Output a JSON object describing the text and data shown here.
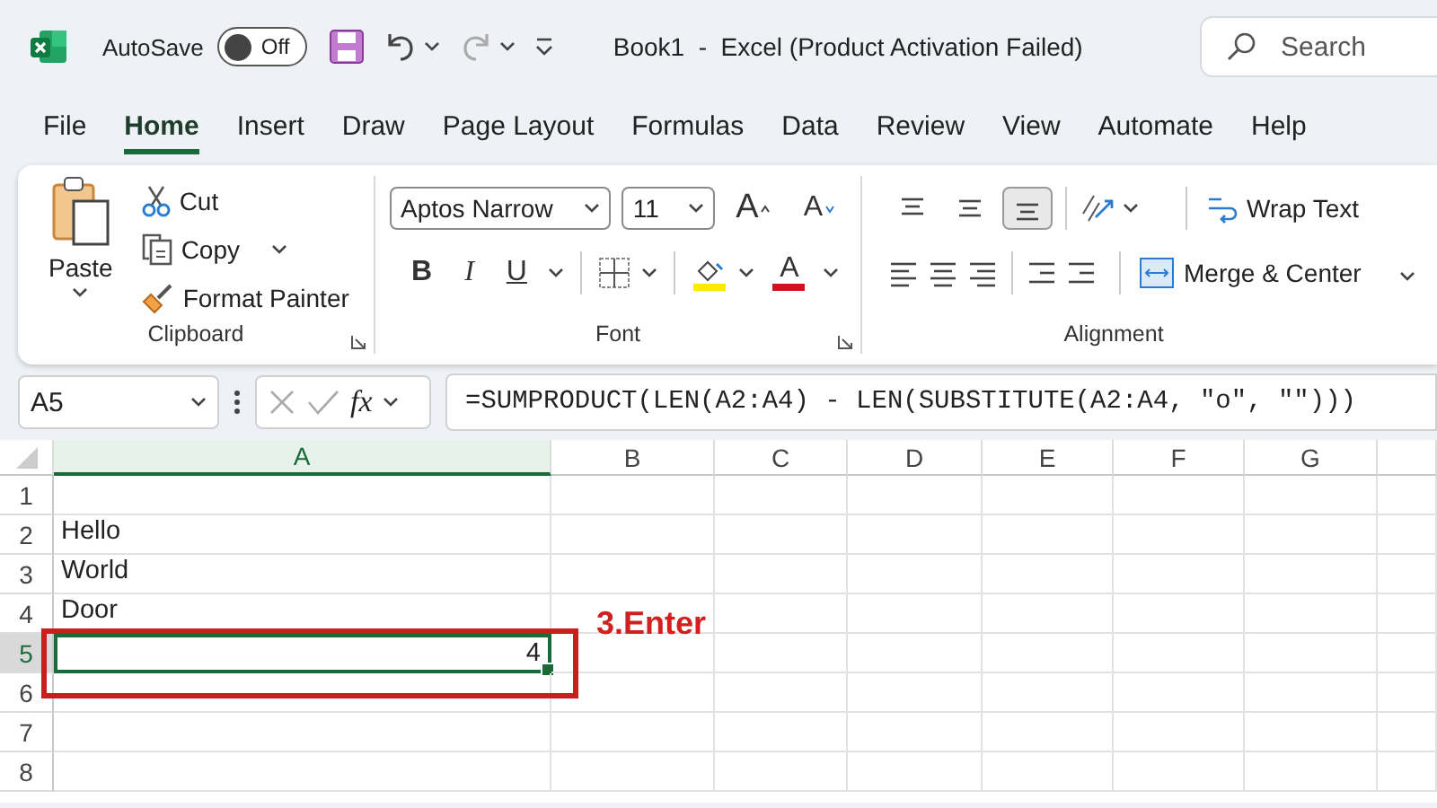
{
  "title_bar": {
    "autosave_label": "AutoSave",
    "autosave": {
      "on": false,
      "label": "Off"
    },
    "title": "Book1  -  Excel (Product Activation Failed)",
    "search": {
      "placeholder": "Search"
    }
  },
  "tabs": [
    {
      "label": "File",
      "selected": false
    },
    {
      "label": "Home",
      "selected": true
    },
    {
      "label": "Insert",
      "selected": false
    },
    {
      "label": "Draw",
      "selected": false
    },
    {
      "label": "Page Layout",
      "selected": false
    },
    {
      "label": "Formulas",
      "selected": false
    },
    {
      "label": "Data",
      "selected": false
    },
    {
      "label": "Review",
      "selected": false
    },
    {
      "label": "View",
      "selected": false
    },
    {
      "label": "Automate",
      "selected": false
    },
    {
      "label": "Help",
      "selected": false
    }
  ],
  "ribbon": {
    "clipboard": {
      "label": "Clipboard",
      "paste": "Paste",
      "cut": "Cut",
      "copy": "Copy",
      "format_painter": "Format Painter"
    },
    "font": {
      "label": "Font",
      "font_name": "Aptos Narrow",
      "font_size": "11",
      "grow": "A",
      "shrink": "A",
      "styles": [
        {
          "kind": "bold",
          "label": "B"
        },
        {
          "kind": "italic",
          "label": "I"
        },
        {
          "kind": "underline",
          "label": "U"
        }
      ],
      "font_color": "A"
    },
    "alignment": {
      "label": "Alignment",
      "vertical": [
        {
          "kind": "top",
          "selected": false
        },
        {
          "kind": "middle",
          "selected": false
        },
        {
          "kind": "bottom",
          "selected": true
        }
      ],
      "wrap_text": "Wrap Text",
      "merge_center": "Merge & Center"
    }
  },
  "formula_bar": {
    "name_box": "A5",
    "function_label": "fx",
    "formula": "=SUMPRODUCT(LEN(A2:A4) - LEN(SUBSTITUTE(A2:A4, \"o\", \"\")))"
  },
  "sheet": {
    "columns": [
      {
        "label": "A",
        "selected": true
      },
      {
        "label": "B",
        "selected": false
      },
      {
        "label": "C",
        "selected": false
      },
      {
        "label": "D",
        "selected": false
      },
      {
        "label": "E",
        "selected": false
      },
      {
        "label": "F",
        "selected": false
      },
      {
        "label": "G",
        "selected": false
      }
    ],
    "rows": [
      {
        "number": "1",
        "selected": false
      },
      {
        "number": "2",
        "selected": false,
        "value": "Hello",
        "kind": "text"
      },
      {
        "number": "3",
        "selected": false,
        "value": "World",
        "kind": "text"
      },
      {
        "number": "4",
        "selected": false,
        "value": "Door",
        "kind": "text"
      },
      {
        "number": "5",
        "selected": true,
        "value": "4",
        "kind": "number"
      },
      {
        "number": "6",
        "selected": false
      },
      {
        "number": "7",
        "selected": false
      },
      {
        "number": "8",
        "selected": false
      }
    ]
  },
  "annotation": {
    "label": "3.Enter"
  }
}
